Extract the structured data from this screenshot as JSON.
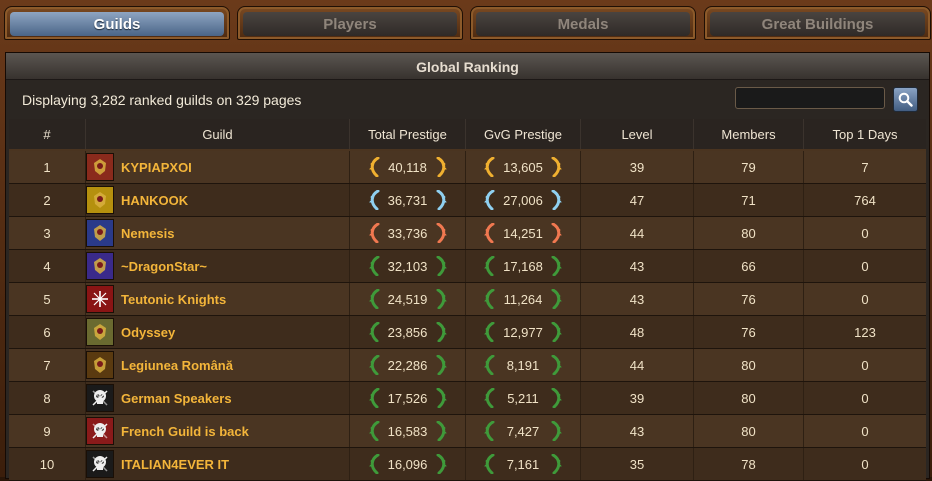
{
  "tabs": [
    {
      "label": "Guilds",
      "active": true
    },
    {
      "label": "Players",
      "active": false
    },
    {
      "label": "Medals",
      "active": false
    },
    {
      "label": "Great Buildings",
      "active": false
    }
  ],
  "panel": {
    "title": "Global Ranking",
    "summary": "Displaying 3,282 ranked guilds on 329 pages",
    "search": {
      "value": "",
      "placeholder": "",
      "button_icon": "magnifier-icon"
    }
  },
  "columns": [
    "#",
    "Guild",
    "Total Prestige",
    "GvG Prestige",
    "Level",
    "Members",
    "Top 1 Days"
  ],
  "laurel_colors": {
    "gold": "#f0b030",
    "silver": "#8fd0f0",
    "bronze": "#f07850",
    "green": "#3f9a3a"
  },
  "rows": [
    {
      "rank": "1",
      "name": "KYPIAPXOI",
      "total_prestige": "40,118",
      "gvg_prestige": "13,605",
      "level": "39",
      "members": "79",
      "top1_days": "7",
      "tier": "gold",
      "emblem_color": "#8a2a1c",
      "emblem_icon": "dragon-icon"
    },
    {
      "rank": "2",
      "name": "HANKOOK",
      "total_prestige": "36,731",
      "gvg_prestige": "27,006",
      "level": "47",
      "members": "71",
      "top1_days": "764",
      "tier": "silver",
      "emblem_color": "#b5900e",
      "emblem_icon": "beast-icon"
    },
    {
      "rank": "3",
      "name": "Nemesis",
      "total_prestige": "33,736",
      "gvg_prestige": "14,251",
      "level": "44",
      "members": "80",
      "top1_days": "0",
      "tier": "bronze",
      "emblem_color": "#2a3a8a",
      "emblem_icon": "lion-icon"
    },
    {
      "rank": "4",
      "name": "~DragonStar~",
      "total_prestige": "32,103",
      "gvg_prestige": "17,168",
      "level": "43",
      "members": "66",
      "top1_days": "0",
      "tier": "green",
      "emblem_color": "#3a2a8a",
      "emblem_icon": "dragon-icon"
    },
    {
      "rank": "5",
      "name": "Teutonic Knights",
      "total_prestige": "24,519",
      "gvg_prestige": "11,264",
      "level": "43",
      "members": "76",
      "top1_days": "0",
      "tier": "green",
      "emblem_color": "#8a1414",
      "emblem_icon": "cross-icon"
    },
    {
      "rank": "6",
      "name": "Odyssey",
      "total_prestige": "23,856",
      "gvg_prestige": "12,977",
      "level": "48",
      "members": "76",
      "top1_days": "123",
      "tier": "green",
      "emblem_color": "#6a6a30",
      "emblem_icon": "crest-icon"
    },
    {
      "rank": "7",
      "name": "Legiunea Română",
      "total_prestige": "22,286",
      "gvg_prestige": "8,191",
      "level": "44",
      "members": "80",
      "top1_days": "0",
      "tier": "green",
      "emblem_color": "#5a3a10",
      "emblem_icon": "eagle-icon"
    },
    {
      "rank": "8",
      "name": "German Speakers",
      "total_prestige": "17,526",
      "gvg_prestige": "5,211",
      "level": "39",
      "members": "80",
      "top1_days": "0",
      "tier": "green",
      "emblem_color": "#1a1a1a",
      "emblem_icon": "skull-icon"
    },
    {
      "rank": "9",
      "name": "French Guild is back",
      "total_prestige": "16,583",
      "gvg_prestige": "7,427",
      "level": "43",
      "members": "80",
      "top1_days": "0",
      "tier": "green",
      "emblem_color": "#8a1a1a",
      "emblem_icon": "skull-icon"
    },
    {
      "rank": "10",
      "name": "ITALIAN4EVER IT",
      "total_prestige": "16,096",
      "gvg_prestige": "7,161",
      "level": "35",
      "members": "78",
      "top1_days": "0",
      "tier": "green",
      "emblem_color": "#1a1a1a",
      "emblem_icon": "skull-icon"
    }
  ]
}
